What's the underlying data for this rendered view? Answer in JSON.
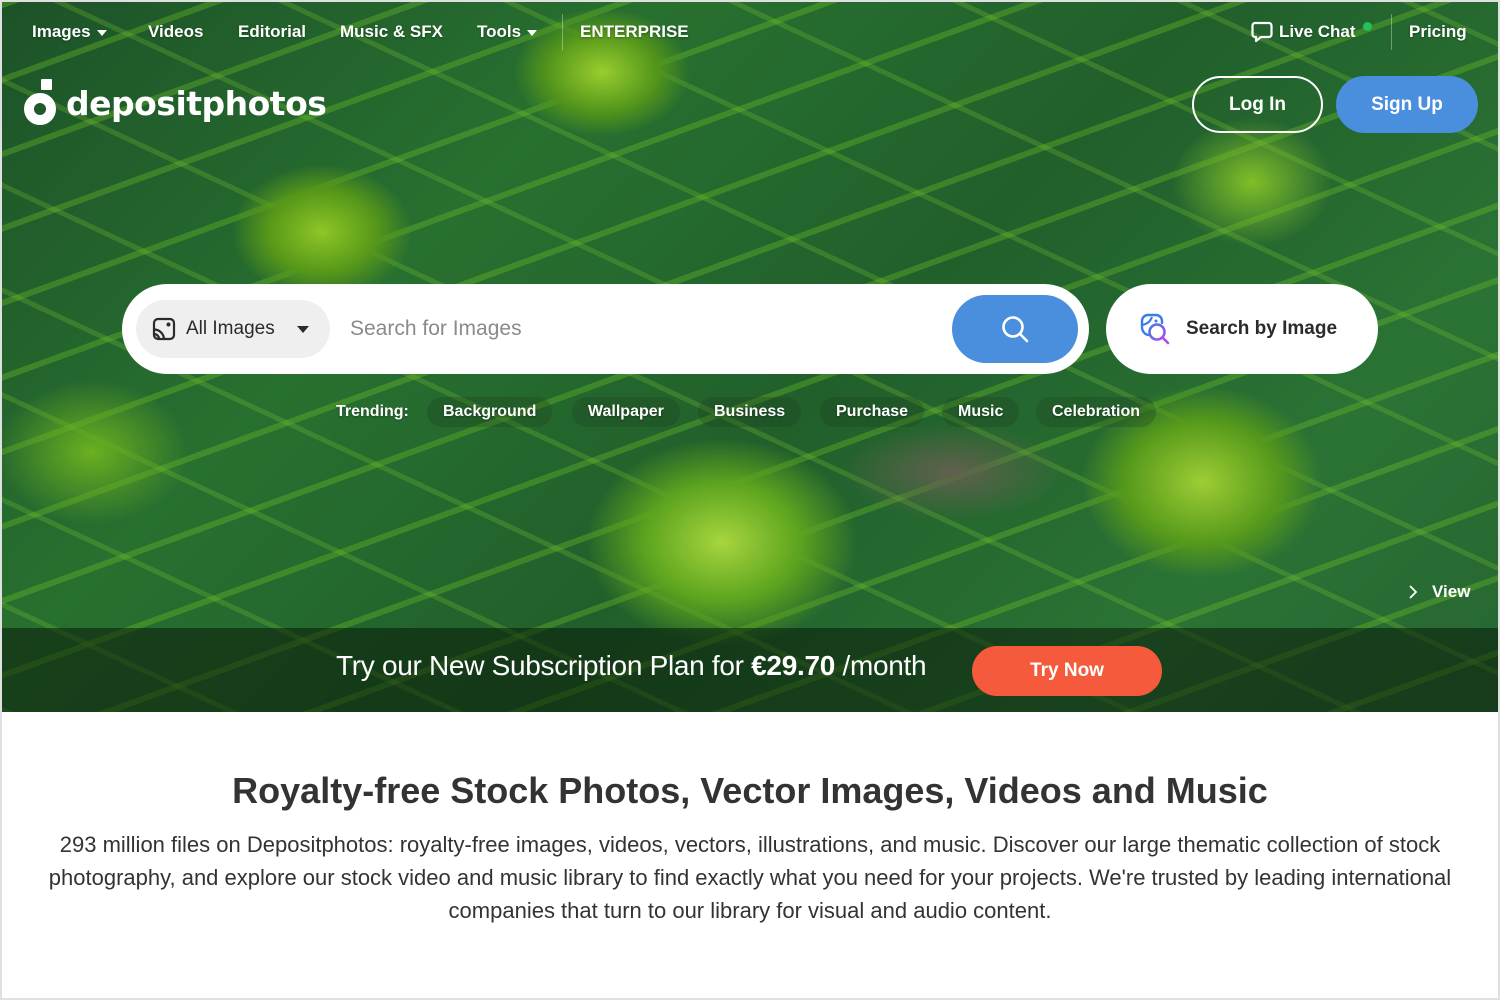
{
  "nav": {
    "left_items": [
      {
        "label": "Images",
        "has_dropdown": true
      },
      {
        "label": "Videos",
        "has_dropdown": false
      },
      {
        "label": "Editorial",
        "has_dropdown": false
      },
      {
        "label": "Music & SFX",
        "has_dropdown": false
      },
      {
        "label": "Tools",
        "has_dropdown": true
      },
      {
        "label": "ENTERPRISE",
        "has_dropdown": false
      }
    ],
    "live_chat": {
      "label": "Live Chat",
      "icon": "chat-bubble-icon",
      "status_color": "#22c25a"
    },
    "pricing": "Pricing"
  },
  "brand": {
    "name": "depositphotos"
  },
  "auth": {
    "login": "Log In",
    "signup": "Sign Up"
  },
  "search": {
    "type_selected": "All Images",
    "placeholder": "Search for Images",
    "value": "",
    "search_icon": "search-icon",
    "by_image_label": "Search by Image"
  },
  "trending": {
    "label": "Trending:",
    "items": [
      "Background",
      "Wallpaper",
      "Business",
      "Purchase",
      "Music",
      "Celebration"
    ]
  },
  "view_link": "View",
  "promo": {
    "text_prefix": "Try our New Subscription Plan for ",
    "price": "€29.70",
    "text_suffix": " /month",
    "cta": "Try Now"
  },
  "content": {
    "headline": "Royalty-free Stock Photos, Vector Images, Videos and Music",
    "description": "293 million files on Depositphotos: royalty-free images, videos, vectors, illustrations, and music. Discover our large thematic collection of stock photography, and explore our stock video and music library to find exactly what you need for your projects. We're trusted by leading international companies that turn to our library for visual and audio content."
  },
  "colors": {
    "primary_blue": "#4a8fde",
    "promo_orange": "#f65a3c",
    "online_green": "#22c25a"
  }
}
